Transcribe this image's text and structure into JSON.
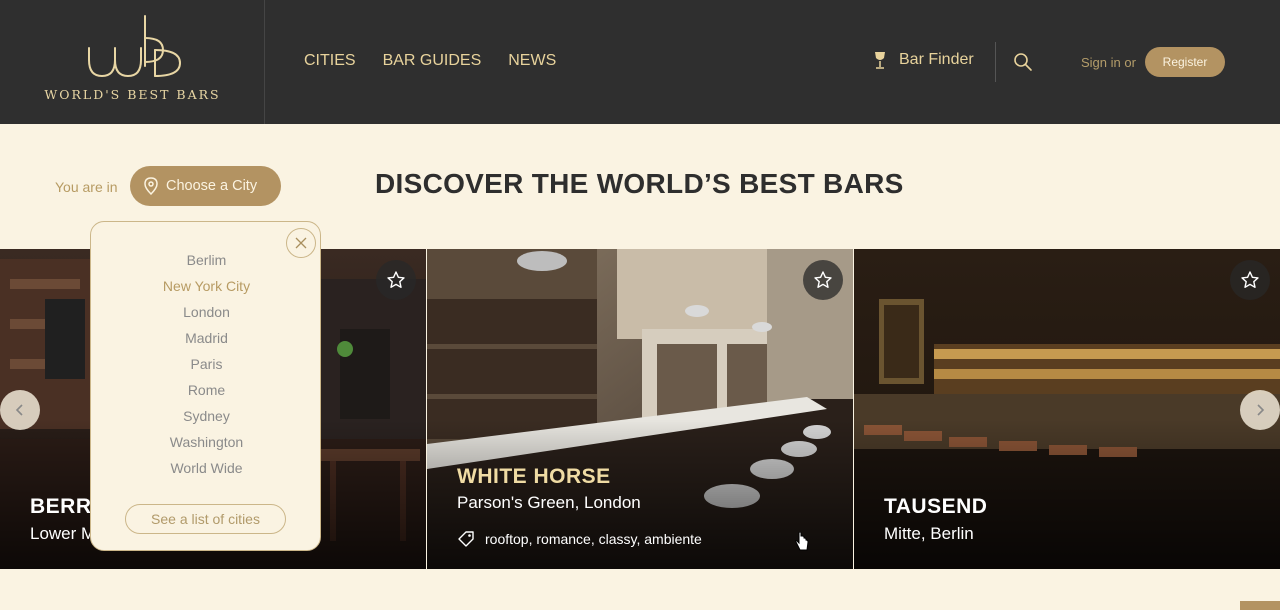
{
  "brand": {
    "logo_text": "WORLD'S BEST BARS",
    "accent": "#b39362",
    "gold": "#e8d39c",
    "header_bg": "#2f2f2f",
    "page_bg": "#faf3e2"
  },
  "nav": {
    "items": [
      "CITIES",
      "BAR GUIDES",
      "NEWS"
    ]
  },
  "header": {
    "bar_finder": "Bar Finder",
    "signin": "Sign in or",
    "register": "Register"
  },
  "location": {
    "label": "You are in",
    "button": "Choose a City"
  },
  "page_title": "DISCOVER THE WORLD’S BEST BARS",
  "dropdown": {
    "cities": [
      "Berlim",
      "New York City",
      "London",
      "Madrid",
      "Paris",
      "Rome",
      "Sydney",
      "Washington",
      "World Wide"
    ],
    "active_city": "New York City",
    "see_list": "See a list of cities"
  },
  "cards": [
    {
      "name": "BERRY",
      "location": "Lower M"
    },
    {
      "name": "WHITE HORSE",
      "location": "Parson's Green, London",
      "tags": "rooftop, romance, classy, ambiente"
    },
    {
      "name": "TAUSEND",
      "location": "Mitte, Berlin"
    }
  ]
}
